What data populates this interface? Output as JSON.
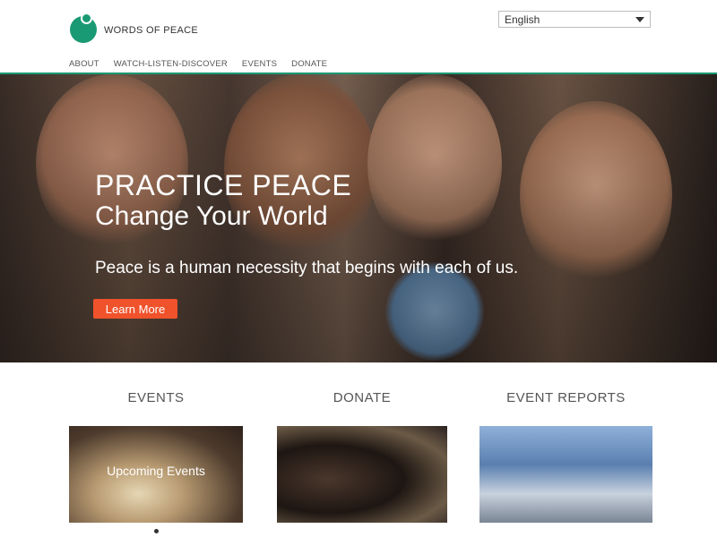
{
  "brand": {
    "name": "WORDS OF PEACE",
    "color": "#1a9a74"
  },
  "language": {
    "selected": "English"
  },
  "nav": {
    "items": [
      {
        "label": "ABOUT"
      },
      {
        "label": "WATCH-LISTEN-DISCOVER"
      },
      {
        "label": "EVENTS"
      },
      {
        "label": "DONATE"
      }
    ]
  },
  "hero": {
    "title": "PRACTICE PEACE",
    "subtitle": "Change Your World",
    "text": "Peace is a human necessity that begins with each of us.",
    "button_label": "Learn More",
    "button_color": "#f0522b"
  },
  "sections": {
    "events": {
      "heading": "EVENTS",
      "thumb_label": "Upcoming Events"
    },
    "donate": {
      "heading": "DONATE"
    },
    "reports": {
      "heading": "EVENT REPORTS"
    }
  }
}
